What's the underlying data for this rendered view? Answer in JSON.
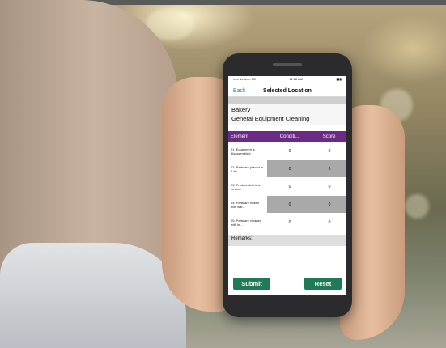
{
  "status_bar": {
    "carrier": "••••• Verizon  3G",
    "time": "11:58 AM",
    "battery": "▮▮▮"
  },
  "nav": {
    "back_label": "Back",
    "title": "Selected Location"
  },
  "location": {
    "name": "Bakery",
    "task": "General Equipment Cleaning"
  },
  "table": {
    "headers": [
      "Element",
      "Conditi...",
      "Score"
    ],
    "rows": [
      {
        "element": "01. Equipment is disassembled",
        "condition": "0",
        "score": "0"
      },
      {
        "element": "02. Parts are placed in 4-tin",
        "condition": "0",
        "score": "0"
      },
      {
        "element": "03. Product debris is remov...",
        "condition": "0",
        "score": "0"
      },
      {
        "element": "04. Parts are rinsed with wat...",
        "condition": "0",
        "score": "0"
      },
      {
        "element": "05. Parts are cleaned with le...",
        "condition": "0",
        "score": "0"
      }
    ]
  },
  "remarks": {
    "label": "Remarks:"
  },
  "actions": {
    "submit_label": "Submit",
    "reset_label": "Reset"
  },
  "colors": {
    "header_purple": "#6b2a86",
    "button_green": "#1f7a57",
    "link_blue": "#2f76c9"
  }
}
